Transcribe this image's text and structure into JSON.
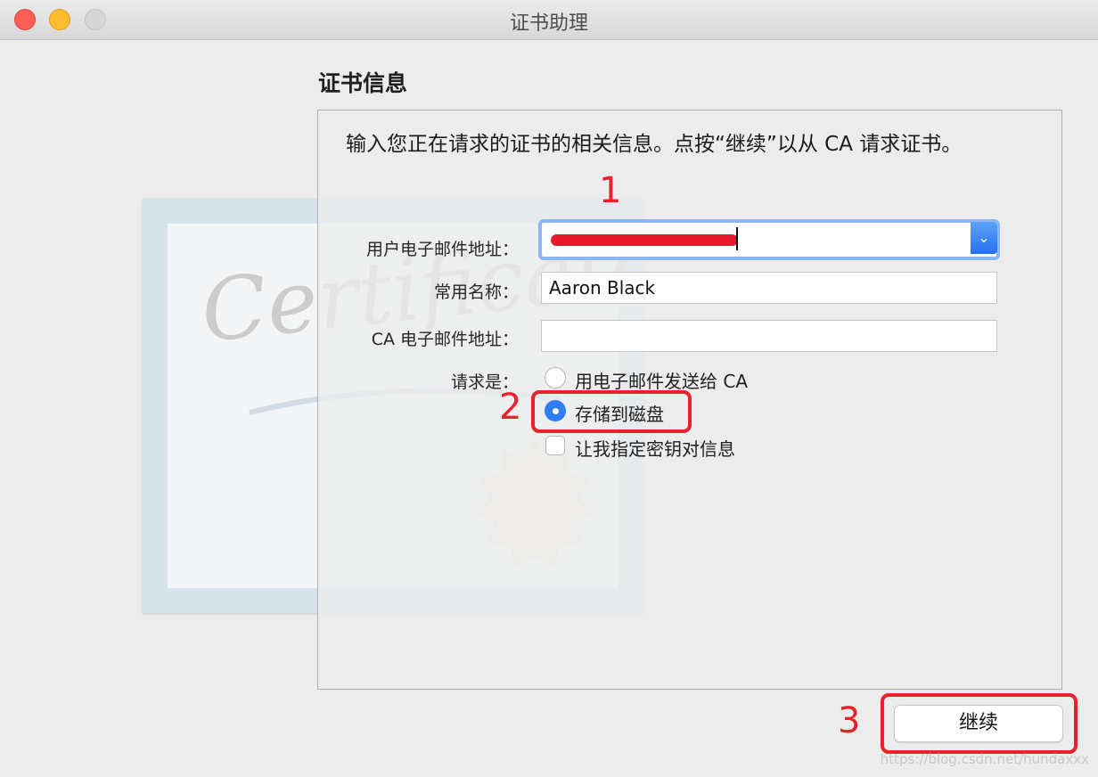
{
  "window": {
    "title": "证书助理"
  },
  "section": {
    "title": "证书信息",
    "intro": "输入您正在请求的证书的相关信息。点按“继续”以从 CA 请求证书。"
  },
  "form": {
    "email_label": "用户电子邮件地址：",
    "email_value": "",
    "common_name_label": "常用名称：",
    "common_name_value": "Aaron Black",
    "ca_email_label": "CA 电子邮件地址：",
    "ca_email_value": "",
    "request_label": "请求是：",
    "option_email_ca": "用电子邮件发送给 CA",
    "option_save_disk": "存储到磁盘",
    "option_specify_key": "让我指定密钥对信息",
    "selected_option": "存储到磁盘"
  },
  "buttons": {
    "continue": "继续"
  },
  "annotations": {
    "one": "1",
    "two": "2",
    "three": "3"
  },
  "art": {
    "certificate_text": "Certificate"
  },
  "watermark": "https://blog.csdn.net/hundaxxx",
  "colors": {
    "accent": "#2f7ef6",
    "annotation_red": "#e8222c"
  }
}
